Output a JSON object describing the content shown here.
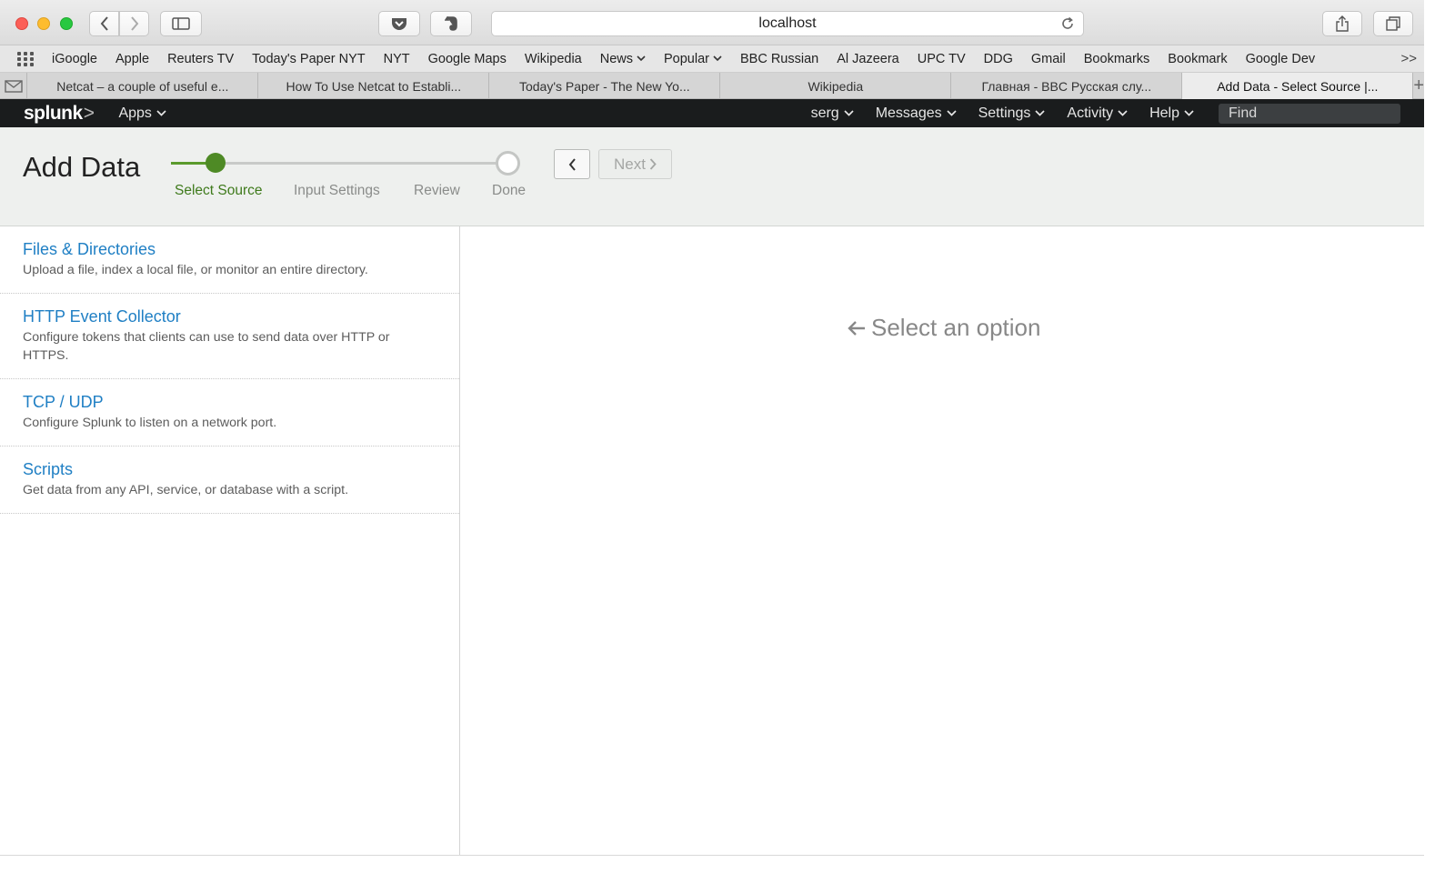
{
  "browser": {
    "url": "localhost",
    "bookmarks": [
      "iGoogle",
      "Apple",
      "Reuters TV",
      "Today's Paper NYT",
      "NYT",
      "Google Maps",
      "Wikipedia",
      "News",
      "Popular",
      "BBC Russian",
      "Al Jazeera",
      "UPC TV",
      "DDG",
      "Gmail",
      "Bookmarks",
      "Bookmark",
      "Google Dev"
    ],
    "bookmark_overflow": ">>",
    "tabs": [
      "Netcat – a couple of useful e...",
      "How To Use Netcat to Establi...",
      "Today's Paper - The New Yo...",
      "Wikipedia",
      "Главная - BBC Русская слу...",
      "Add Data - Select Source |..."
    ],
    "new_tab": "+"
  },
  "splunk": {
    "logo": "splunk",
    "logo_mark": ">",
    "apps_label": "Apps",
    "nav": {
      "user": "serg",
      "messages": "Messages",
      "settings": "Settings",
      "activity": "Activity",
      "help": "Help"
    },
    "find_placeholder": "Find"
  },
  "wizard": {
    "title": "Add Data",
    "steps": [
      "Select Source",
      "Input Settings",
      "Review",
      "Done"
    ],
    "current_step": 0,
    "next_label": "Next"
  },
  "sources": [
    {
      "title": "Files & Directories",
      "desc": "Upload a file, index a local file, or monitor an entire directory."
    },
    {
      "title": "HTTP Event Collector",
      "desc": "Configure tokens that clients can use to send data over HTTP or HTTPS."
    },
    {
      "title": "TCP / UDP",
      "desc": "Configure Splunk to listen on a network port."
    },
    {
      "title": "Scripts",
      "desc": "Get data from any API, service, or database with a script."
    }
  ],
  "detail": {
    "hint": "Select an option"
  },
  "colors": {
    "splunk_bar": "#1a1c1d",
    "step_active": "#4e8a25",
    "link": "#1f7fc4"
  }
}
